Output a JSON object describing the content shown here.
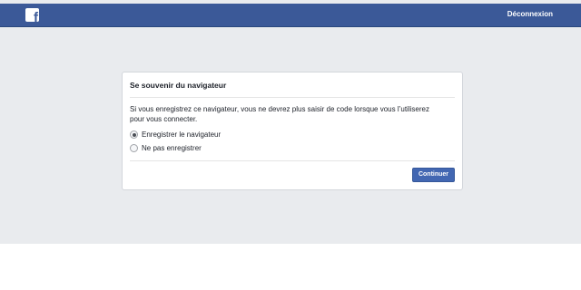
{
  "header": {
    "logo_letter": "f",
    "logout_label": "Déconnexion",
    "bar_color": "#3b5998"
  },
  "dialog": {
    "title": "Se souvenir du navigateur",
    "description": "Si vous enregistrez ce navigateur, vous ne devrez plus saisir de code lorsque vous l’utiliserez pour vous connecter.",
    "options": [
      {
        "label": "Enregistrer le navigateur",
        "selected": true
      },
      {
        "label": "Ne pas enregistrer",
        "selected": false
      }
    ],
    "continue_label": "Continuer"
  },
  "colors": {
    "background": "#e9ebee",
    "button": "#4267b2"
  }
}
